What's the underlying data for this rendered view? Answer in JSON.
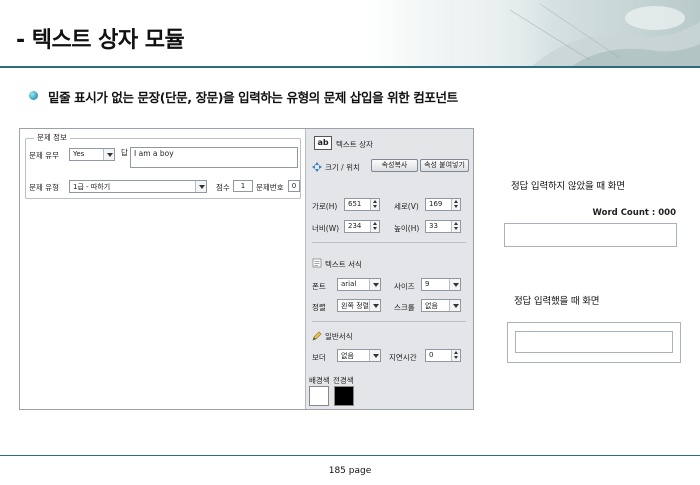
{
  "header": {
    "title": "- 텍스트 상자 모듈"
  },
  "subtitle": "밑줄 표시가 없는 문장(단문, 장문)을 입력하는 유형의 문제 삽입을 위한 컴포넌트",
  "panel": {
    "group_label": "문제 정보",
    "has_problem_label": "문제 유무",
    "has_problem_value": "Yes",
    "answer_label": "답",
    "answer_value": "I am a boy",
    "problem_type_label": "문제 유형",
    "problem_type_value": "1급 - 따하기",
    "score_label": "점수",
    "score_value": "1",
    "problem_number_label": "문제번호",
    "problem_number_value": "0",
    "textbox_icon_label": "ab",
    "textbox_label": "텍스트 상자",
    "size_position_label": "크기 / 위치",
    "copy_props_button": "속성복사",
    "paste_props_button": "속성 붙여넣기",
    "width_label": "가로(H)",
    "width_value": "651",
    "height_label": "세로(V)",
    "height_value": "169",
    "w_label": "너비(W)",
    "w_value": "234",
    "h_label": "높이(H)",
    "h_value": "33",
    "text_format_label": "텍스트 서식",
    "font_label": "폰트",
    "font_value": "arial",
    "size_label": "사이즈",
    "size_value": "9",
    "align_label": "정렬",
    "align_value": "왼쪽 정렬",
    "scroll_label": "스크롤",
    "scroll_value": "없음",
    "general_format_label": "일반서식",
    "border_label": "보더",
    "border_value": "없음",
    "delay_label": "지연시간",
    "delay_value": "0",
    "bg_color_label": "배경색",
    "border_color_label": "전경색"
  },
  "examples": {
    "not_entered_caption": "정답 입력하지 않았을 때 화면",
    "word_count": "Word Count : 000",
    "entered_caption": "정답 입력했을 때 화면"
  },
  "footer": {
    "page": "185 page"
  },
  "colors": {
    "accent": "#2c6d7e",
    "panel_right_bg": "#e3e5e8",
    "bg_swatch": "#ffffff",
    "fg_swatch": "#000000"
  }
}
